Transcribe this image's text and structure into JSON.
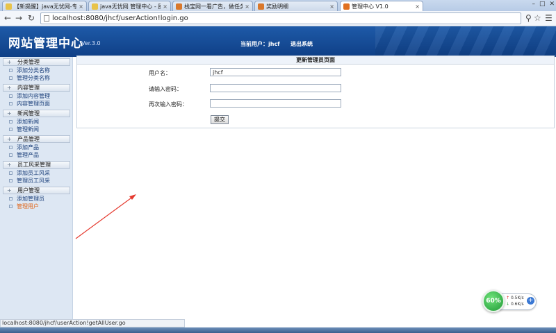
{
  "browser": {
    "tabs": [
      {
        "title": "【新提醒】java无忧网-专",
        "fav_color": "#e8c34a",
        "active": false
      },
      {
        "title": "java无忧网 管理中心 - 圈",
        "fav_color": "#e8c34a",
        "active": false
      },
      {
        "title": "栈宝网一看广告，做任务",
        "fav_color": "#d9782c",
        "active": false
      },
      {
        "title": "奖励明细",
        "fav_color": "#d9782c",
        "active": false
      },
      {
        "title": "管理中心 V1.0",
        "fav_color": "#e07020",
        "active": true
      }
    ],
    "url": "localhost:8080/jhcf/userAction!login.go"
  },
  "header": {
    "site_title": "网站管理中心",
    "version": "Ver.3.0",
    "current_user_label": "当前用户：",
    "current_user": "jhcf",
    "logout_label": "退出系统"
  },
  "sidebar": {
    "groups": [
      {
        "title": "分类管理",
        "items": [
          "添加分类名称",
          "管理分类名称"
        ]
      },
      {
        "title": "内容管理",
        "items": [
          "添加内容管理",
          "内容管理页面"
        ]
      },
      {
        "title": "新闻管理",
        "items": [
          "添加新闻",
          "管理新闻"
        ]
      },
      {
        "title": "产品管理",
        "items": [
          "添加产品",
          "管理产品"
        ]
      },
      {
        "title": "员工风采管理",
        "items": [
          "添加员工风采",
          "管理员工风采"
        ]
      },
      {
        "title": "用户管理",
        "items": [
          "添加管理员",
          "管理用户"
        ]
      }
    ],
    "selected_item": "管理用户"
  },
  "form": {
    "title": "更新管理员页面",
    "username_label": "用户名：",
    "username_value": "jhcf",
    "password_label": "请输入密码：",
    "password_value": "",
    "confirm_label": "再次输入密码：",
    "confirm_value": "",
    "submit_label": "提交"
  },
  "status": {
    "text": "localhost:8080/jhcf/userAction!getAllUser.go"
  },
  "net_widget": {
    "percent": "60%",
    "upload": "0.5K/s",
    "download": "0.6K/s"
  },
  "colors": {
    "header_blue": "#1e5aa8",
    "selected_link": "#e0661a",
    "annotation_arrow": "#e53a2f"
  }
}
